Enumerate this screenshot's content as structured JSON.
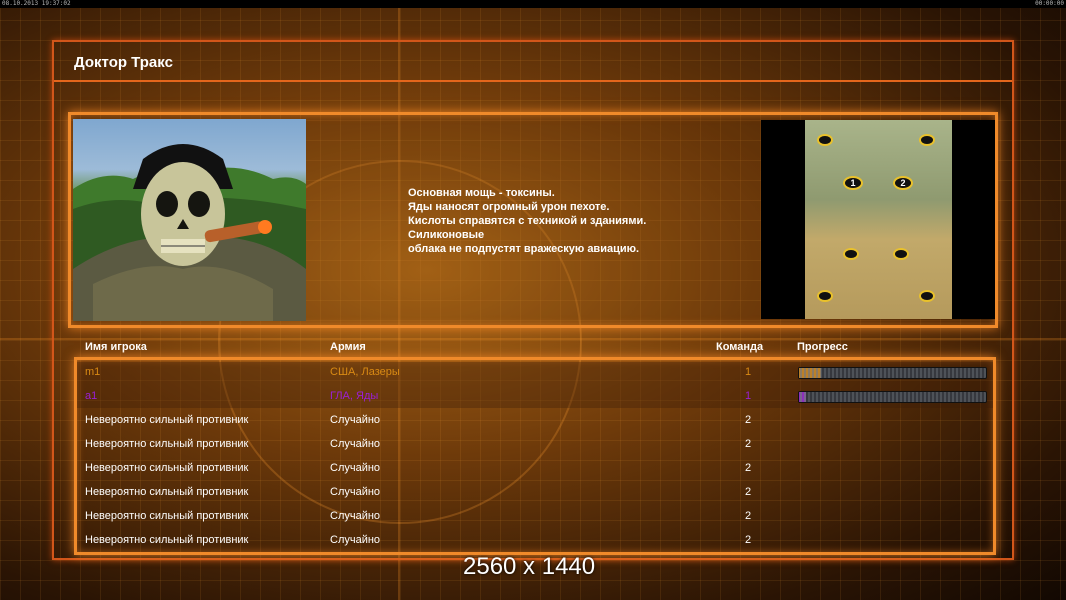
{
  "topbar": {
    "left": "08.10.2013 19:37:02",
    "right": "00:00:00"
  },
  "window": {
    "title": "Доктор Тракс"
  },
  "general": {
    "description": [
      "Основная мощь - токсины.",
      "Яды наносят огромный урон пехоте.",
      "Кислоты справятся с техникой и зданиями.",
      "Силиконовые",
      "облака не подпустят вражескую авиацию."
    ],
    "portrait_icon": "skull-mask-general-portrait"
  },
  "minimap": {
    "start_positions": [
      "1",
      "2"
    ]
  },
  "table": {
    "headers": {
      "name": "Имя игрока",
      "army": "Армия",
      "team": "Команда",
      "progress": "Прогресс"
    },
    "rows": [
      {
        "name": "m1",
        "army": "США, Лазеры",
        "team": "1",
        "color": "#d98a14",
        "progress": 0.12
      },
      {
        "name": "a1",
        "army": "ГЛА, Яды",
        "team": "1",
        "color": "#9a1fd6",
        "progress": 0.04
      },
      {
        "name": "Невероятно сильный противник",
        "army": "Случайно",
        "team": "2",
        "color": "#ffffff"
      },
      {
        "name": "Невероятно сильный противник",
        "army": "Случайно",
        "team": "2",
        "color": "#ffffff"
      },
      {
        "name": "Невероятно сильный противник",
        "army": "Случайно",
        "team": "2",
        "color": "#ffffff"
      },
      {
        "name": "Невероятно сильный противник",
        "army": "Случайно",
        "team": "2",
        "color": "#ffffff"
      },
      {
        "name": "Невероятно сильный противник",
        "army": "Случайно",
        "team": "2",
        "color": "#ffffff"
      },
      {
        "name": "Невероятно сильный противник",
        "army": "Случайно",
        "team": "2",
        "color": "#ffffff"
      }
    ]
  },
  "watermark": "2560 x 1440"
}
